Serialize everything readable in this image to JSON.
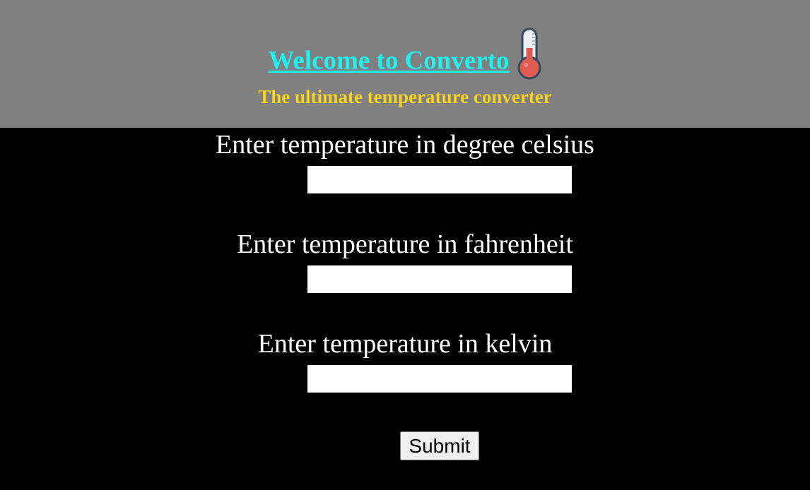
{
  "header": {
    "title": "Welcome to Converto",
    "subtitle": "The ultimate temperature converter",
    "icon": "thermometer-icon",
    "colors": {
      "background": "#808080",
      "title": "#1ff0f0",
      "subtitle": "#f6d21f"
    }
  },
  "form": {
    "fields": [
      {
        "label": "Enter temperature in degree celsius",
        "value": "",
        "placeholder": ""
      },
      {
        "label": "Enter temperature in fahrenheit",
        "value": "",
        "placeholder": ""
      },
      {
        "label": "Enter temperature in kelvin",
        "value": "",
        "placeholder": ""
      }
    ],
    "submit_label": "Submit"
  },
  "colors": {
    "page_background": "#000000",
    "label_text": "#ffffff"
  }
}
